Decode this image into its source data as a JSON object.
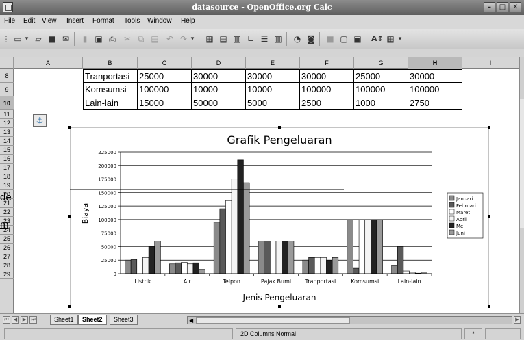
{
  "window": {
    "title": "datasource - OpenOffice.org Calc",
    "controls": [
      "–",
      "□",
      "✕"
    ]
  },
  "menu": [
    "File",
    "Edit",
    "View",
    "Insert",
    "Format",
    "Tools",
    "Window",
    "Help"
  ],
  "columns": [
    "A",
    "B",
    "C",
    "D",
    "E",
    "F",
    "G",
    "H",
    "I"
  ],
  "selected_column": "H",
  "rows": [
    "8",
    "9",
    "10",
    "11",
    "12",
    "13",
    "14",
    "15",
    "16",
    "17",
    "18",
    "19",
    "20",
    "21",
    "22",
    "23",
    "24",
    "25",
    "26",
    "27",
    "28",
    "29"
  ],
  "selected_row": "10",
  "table": [
    [
      "Tranportasi",
      "25000",
      "30000",
      "30000",
      "30000",
      "25000",
      "30000"
    ],
    [
      "Komsumsi",
      "100000",
      "10000",
      "10000",
      "100000",
      "100000",
      "100000"
    ],
    [
      "Lain-lain",
      "15000",
      "50000",
      "5000",
      "2500",
      "1000",
      "2750"
    ]
  ],
  "left_stub": {
    "line1": "de",
    "line2": "m"
  },
  "chart_data": {
    "type": "bar",
    "title": "Grafik Pengeluaran",
    "xlabel": "Jenis Pengeluaran",
    "ylabel": "Biaya",
    "ylim": [
      0,
      225000
    ],
    "yticks": [
      "0",
      "25000",
      "50000",
      "75000",
      "100000",
      "125000",
      "150000",
      "175000",
      "200000",
      "225000"
    ],
    "grid": true,
    "legend_position": "right",
    "categories": [
      "Listrik",
      "Air",
      "Telpon",
      "Pajak Bumi",
      "Tranportasi",
      "Komsumsi",
      "Lain-lain"
    ],
    "series": [
      {
        "name": "Januari",
        "color": "#8a8a8a",
        "values": [
          25000,
          18000,
          95000,
          60000,
          25000,
          100000,
          15000
        ]
      },
      {
        "name": "Februari",
        "color": "#5a5a5a",
        "values": [
          26000,
          20000,
          120000,
          60000,
          30000,
          10000,
          50000
        ]
      },
      {
        "name": "Maret",
        "color": "#ffffff",
        "values": [
          27000,
          21000,
          135000,
          60000,
          30000,
          100000,
          5000
        ]
      },
      {
        "name": "April",
        "color": "#f4f4f4",
        "values": [
          30000,
          18000,
          175000,
          60000,
          30000,
          100000,
          2500
        ]
      },
      {
        "name": "Mei",
        "color": "#222222",
        "values": [
          50000,
          20000,
          210000,
          60000,
          25000,
          100000,
          1000
        ]
      },
      {
        "name": "Juni",
        "color": "#9a9a9a",
        "values": [
          60000,
          8000,
          168000,
          60000,
          30000,
          100000,
          2750
        ]
      }
    ]
  },
  "sheet_tabs": [
    "Sheet1",
    "Sheet2",
    "Sheet3"
  ],
  "active_sheet": "Sheet2",
  "status": {
    "mode": "2D Columns Normal",
    "marker": "*"
  }
}
